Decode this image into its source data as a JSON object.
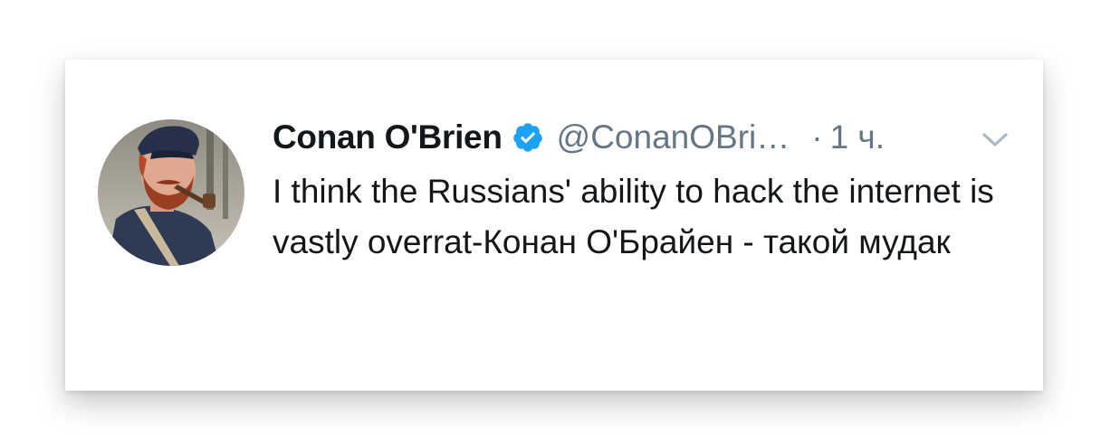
{
  "tweet": {
    "author_name": "Conan O'Brien",
    "handle": "@ConanOBri…",
    "separator": "·",
    "time": "1 ч.",
    "text": "I think the Russians' ability to hack the internet is vastly overrat-Конан О'Брайен - такой мудак",
    "verified": true
  },
  "icons": {
    "verified": "verified-badge-icon",
    "menu": "chevron-down-icon",
    "avatar": "avatar"
  },
  "colors": {
    "verified_blue": "#1da1f2",
    "secondary_text": "#657786",
    "primary_text": "#14171a"
  }
}
